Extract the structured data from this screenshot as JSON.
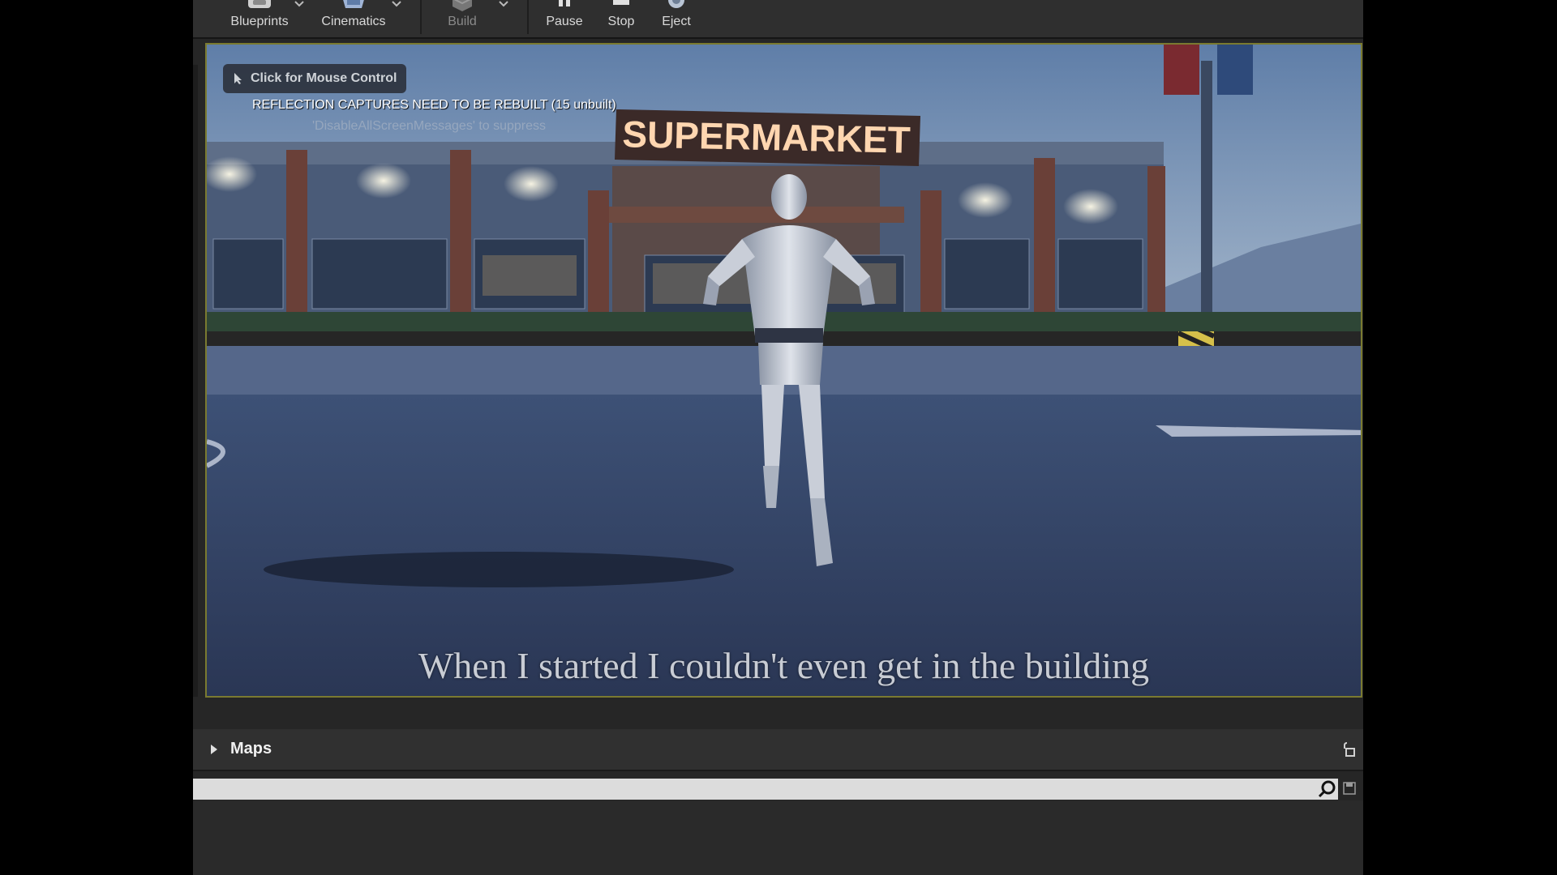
{
  "toolbar": {
    "blueprints_label": "Blueprints",
    "cinematics_label": "Cinematics",
    "build_label": "Build",
    "pause_label": "Pause",
    "stop_label": "Stop",
    "eject_label": "Eject"
  },
  "viewport": {
    "mouse_hint": "Click for Mouse Control",
    "rebuild_message": "REFLECTION CAPTURES NEED TO BE REBUILT (15 unbuilt)",
    "suppress_message": "'DisableAllScreenMessages' to suppress",
    "scene": {
      "store_sign": "SUPERMARKET"
    }
  },
  "subtitle": "When I started I couldn't even get in the building",
  "maps_panel": {
    "title": "Maps",
    "search_value": "",
    "search_placeholder": ""
  },
  "colors": {
    "editor_bg": "#262626",
    "toolbar_bg": "#2f2f2f",
    "sign_text": "#ffd6b0",
    "search_bg": "#dcdcdc"
  }
}
